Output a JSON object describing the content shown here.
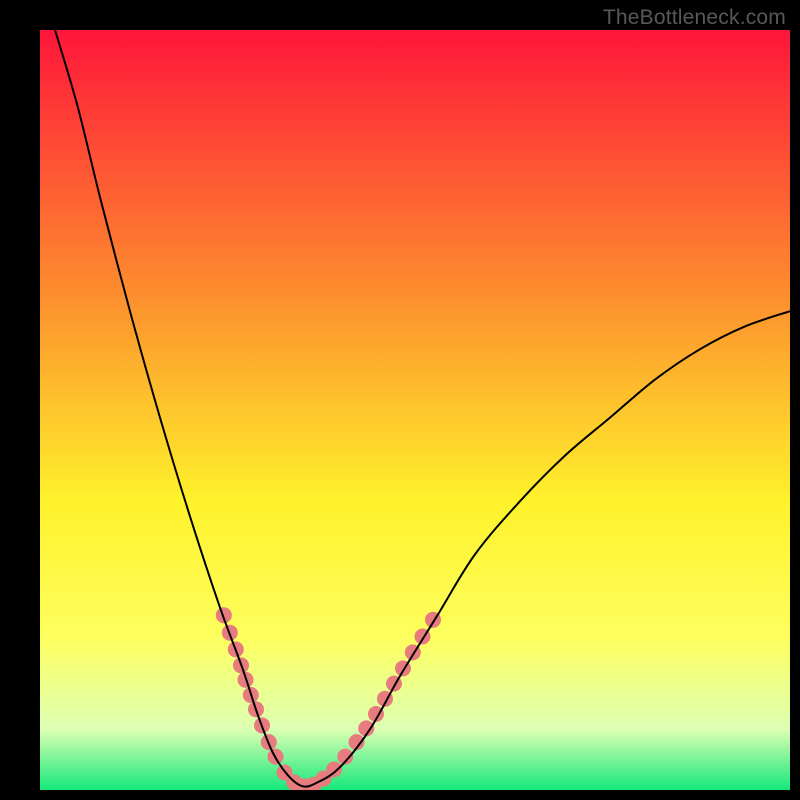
{
  "watermark": "TheBottleneck.com",
  "chart_data": {
    "type": "line",
    "title": "",
    "xlabel": "",
    "ylabel": "",
    "xlim": [
      0,
      100
    ],
    "ylim": [
      0,
      100
    ],
    "grid": false,
    "legend": false,
    "background_gradient": {
      "top": "#fe163a",
      "mid_upper": "#fd8f2e",
      "mid": "#fef22b",
      "mid_lower": "#feff5f",
      "lower": "#dcffb3",
      "bottom": "#15e87b"
    },
    "series": [
      {
        "name": "bottleneck-curve",
        "color": "#000000",
        "x": [
          2,
          5,
          8,
          12,
          16,
          20,
          24,
          27,
          29,
          31,
          33,
          35,
          37,
          40,
          44,
          48,
          53,
          58,
          64,
          70,
          76,
          82,
          88,
          94,
          100
        ],
        "y": [
          100,
          90,
          78,
          63,
          49,
          36,
          24,
          16,
          10,
          5,
          2,
          0.5,
          1,
          3,
          8,
          15,
          23,
          31,
          38,
          44,
          49,
          54,
          58,
          61,
          63
        ]
      }
    ],
    "markers": {
      "name": "highlighted-segments",
      "color": "#e77b7e",
      "radius_px": 8,
      "points": [
        {
          "x": 24.5,
          "y": 23
        },
        {
          "x": 25.3,
          "y": 20.7
        },
        {
          "x": 26.1,
          "y": 18.5
        },
        {
          "x": 26.8,
          "y": 16.4
        },
        {
          "x": 27.4,
          "y": 14.5
        },
        {
          "x": 28.1,
          "y": 12.5
        },
        {
          "x": 28.8,
          "y": 10.6
        },
        {
          "x": 29.6,
          "y": 8.5
        },
        {
          "x": 30.5,
          "y": 6.3
        },
        {
          "x": 31.4,
          "y": 4.4
        },
        {
          "x": 32.6,
          "y": 2.3
        },
        {
          "x": 33.9,
          "y": 1.0
        },
        {
          "x": 35.2,
          "y": 0.5
        },
        {
          "x": 36.5,
          "y": 0.7
        },
        {
          "x": 37.8,
          "y": 1.5
        },
        {
          "x": 39.2,
          "y": 2.7
        },
        {
          "x": 40.7,
          "y": 4.4
        },
        {
          "x": 42.2,
          "y": 6.3
        },
        {
          "x": 43.5,
          "y": 8.1
        },
        {
          "x": 44.8,
          "y": 10.0
        },
        {
          "x": 46.0,
          "y": 12.0
        },
        {
          "x": 47.2,
          "y": 14.0
        },
        {
          "x": 48.4,
          "y": 16.0
        },
        {
          "x": 49.7,
          "y": 18.1
        },
        {
          "x": 51.0,
          "y": 20.2
        },
        {
          "x": 52.4,
          "y": 22.4
        }
      ]
    }
  }
}
